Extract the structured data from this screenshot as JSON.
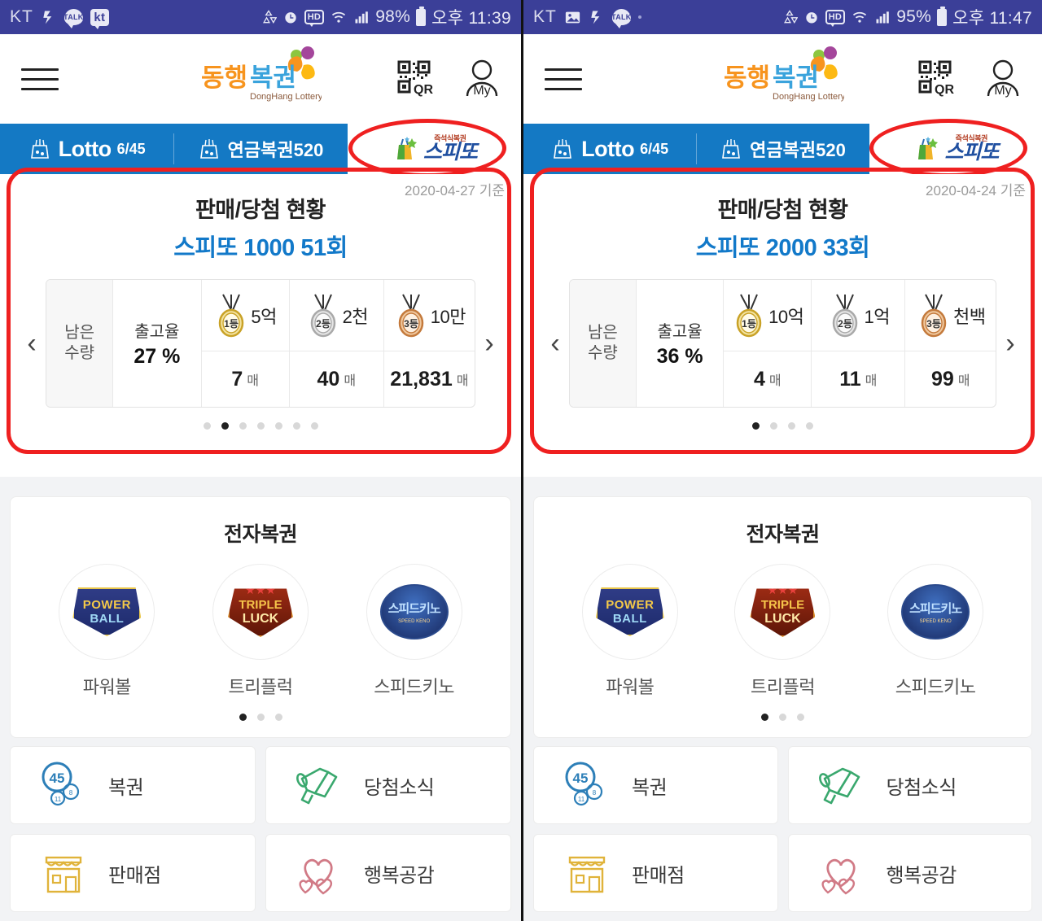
{
  "screens": [
    {
      "id": "left",
      "statusbar": {
        "carrier": "KT",
        "icons": [
          "vibrate-icon",
          "kakaotalk-icon",
          "kt-app-icon"
        ],
        "right_icons": [
          "data-saver-icon",
          "alarm-icon",
          "hd-icon",
          "wifi-icon",
          "signal-icon"
        ],
        "battery_percent": "98%",
        "time": "오후 11:39"
      },
      "header": {
        "menu_icon": "hamburger-icon",
        "logo_main": "동행복권",
        "logo_sub": "DongHang Lottery",
        "qr_label": "QR",
        "my_label": "My"
      },
      "tabs": [
        {
          "label": "Lotto",
          "sub": "6/45",
          "active": false
        },
        {
          "label": "연금복권520",
          "sub": "",
          "active": false
        },
        {
          "label": "스피또",
          "sub": "즉석식복권",
          "active": true
        }
      ],
      "card": {
        "base_date": "2020-04-27 기준",
        "title": "판매/당첨 현황",
        "subtitle": "스피또 1000 51회",
        "remaining_label_line1": "남은",
        "remaining_label_line2": "수량",
        "prizes": [
          {
            "rank": "1등",
            "amount": "5억",
            "count": "7",
            "unit": "매"
          },
          {
            "rank": "2등",
            "amount": "2천",
            "count": "40",
            "unit": "매"
          },
          {
            "rank": "3등",
            "amount": "10만",
            "count": "21,831",
            "unit": "매"
          }
        ],
        "rate_label": "출고율",
        "rate_value": "27 %",
        "prev_arrow": "‹",
        "next_arrow": "›",
        "dot_count": 7,
        "dot_active": 1
      },
      "electronic": {
        "title": "전자복권",
        "items": [
          {
            "logo_line1": "POWER",
            "logo_line2": "BALL",
            "label": "파워볼"
          },
          {
            "logo_line1": "TRIPLE",
            "logo_line2": "LUCK",
            "label": "트리플럭"
          },
          {
            "logo_line1": "스피드키노",
            "logo_line2": "SPEED KENO",
            "label": "스피드키노"
          }
        ],
        "dot_count": 3,
        "dot_active": 0
      },
      "menu": [
        {
          "icon": "lottery-balls-icon",
          "label": "복권"
        },
        {
          "icon": "megaphone-icon",
          "label": "당첨소식"
        },
        {
          "icon": "store-icon",
          "label": "판매점"
        },
        {
          "icon": "hearts-icon",
          "label": "행복공감"
        }
      ]
    },
    {
      "id": "right",
      "statusbar": {
        "carrier": "KT",
        "icons": [
          "photo-icon",
          "vibrate-icon",
          "kakaotalk-icon",
          "dot-icon"
        ],
        "right_icons": [
          "data-saver-icon",
          "alarm-icon",
          "hd-icon",
          "wifi-icon",
          "signal-icon"
        ],
        "battery_percent": "95%",
        "time": "오후 11:47"
      },
      "header": {
        "menu_icon": "hamburger-icon",
        "logo_main": "동행복권",
        "logo_sub": "DongHang Lottery",
        "qr_label": "QR",
        "my_label": "My"
      },
      "tabs": [
        {
          "label": "Lotto",
          "sub": "6/45",
          "active": false
        },
        {
          "label": "연금복권520",
          "sub": "",
          "active": false
        },
        {
          "label": "스피또",
          "sub": "즉석식복권",
          "active": true
        }
      ],
      "card": {
        "base_date": "2020-04-24 기준",
        "title": "판매/당첨 현황",
        "subtitle": "스피또 2000 33회",
        "remaining_label_line1": "남은",
        "remaining_label_line2": "수량",
        "prizes": [
          {
            "rank": "1등",
            "amount": "10억",
            "count": "4",
            "unit": "매"
          },
          {
            "rank": "2등",
            "amount": "1억",
            "count": "11",
            "unit": "매"
          },
          {
            "rank": "3등",
            "amount": "천백",
            "count": "99",
            "unit": "매"
          }
        ],
        "rate_label": "출고율",
        "rate_value": "36 %",
        "prev_arrow": "‹",
        "next_arrow": "›",
        "dot_count": 4,
        "dot_active": 0
      },
      "electronic": {
        "title": "전자복권",
        "items": [
          {
            "logo_line1": "POWER",
            "logo_line2": "BALL",
            "label": "파워볼"
          },
          {
            "logo_line1": "TRIPLE",
            "logo_line2": "LUCK",
            "label": "트리플럭"
          },
          {
            "logo_line1": "스피드키노",
            "logo_line2": "SPEED KENO",
            "label": "스피드키노"
          }
        ],
        "dot_count": 3,
        "dot_active": 0
      },
      "menu": [
        {
          "icon": "lottery-balls-icon",
          "label": "복권"
        },
        {
          "icon": "megaphone-icon",
          "label": "당첨소식"
        },
        {
          "icon": "store-icon",
          "label": "판매점"
        },
        {
          "icon": "hearts-icon",
          "label": "행복공감"
        }
      ]
    }
  ],
  "colors": {
    "statusbar_bg": "#3b3f98",
    "tab_bg": "#1479c4",
    "accent_blue": "#1279c9",
    "highlight_red": "#ef2020",
    "page_bg": "#f2f3f5"
  }
}
